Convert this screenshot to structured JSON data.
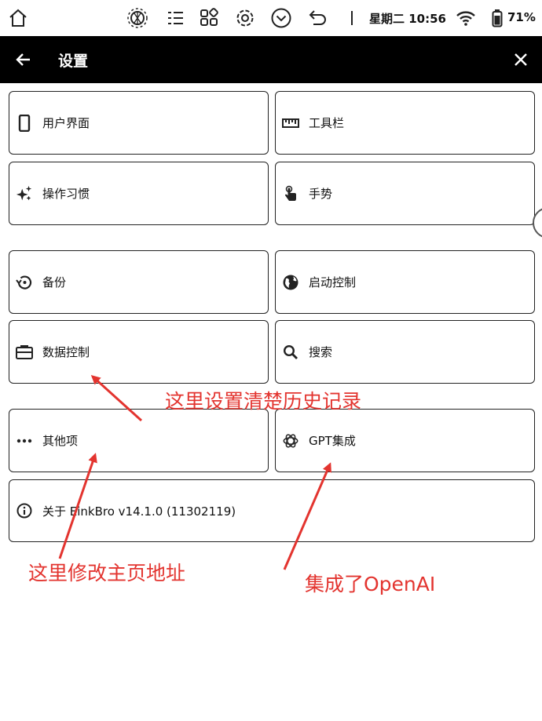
{
  "status_bar": {
    "datetime": "星期二 10:56",
    "battery": "71%",
    "icons": [
      "home-icon",
      "brightness-icon",
      "list-icon",
      "apps-icon",
      "gear-icon",
      "chevron-down-icon",
      "undo-icon",
      "wifi-icon",
      "battery-icon"
    ]
  },
  "header": {
    "title": "设置"
  },
  "settings": {
    "items": [
      {
        "label": "用户界面",
        "icon": "phone-icon"
      },
      {
        "label": "工具栏",
        "icon": "ruler-icon"
      },
      {
        "label": "操作习惯",
        "icon": "sparkle-icon"
      },
      {
        "label": "手势",
        "icon": "touch-icon"
      },
      {
        "label": "备份",
        "icon": "restore-icon"
      },
      {
        "label": "启动控制",
        "icon": "globe-icon"
      },
      {
        "label": "数据控制",
        "icon": "briefcase-icon"
      },
      {
        "label": "搜索",
        "icon": "search-icon"
      },
      {
        "label": "其他项",
        "icon": "more-icon"
      },
      {
        "label": "GPT集成",
        "icon": "openai-icon"
      },
      {
        "label": "关于 EinkBro v14.1.0 (11302119)",
        "icon": "info-icon"
      }
    ]
  },
  "annotations": {
    "clear_history": "这里设置清楚历史记录",
    "homepage": "这里修改主页地址",
    "openai": "集成了OpenAI"
  },
  "colors": {
    "annotation": "#e3342f",
    "titlebar": "#000000"
  }
}
